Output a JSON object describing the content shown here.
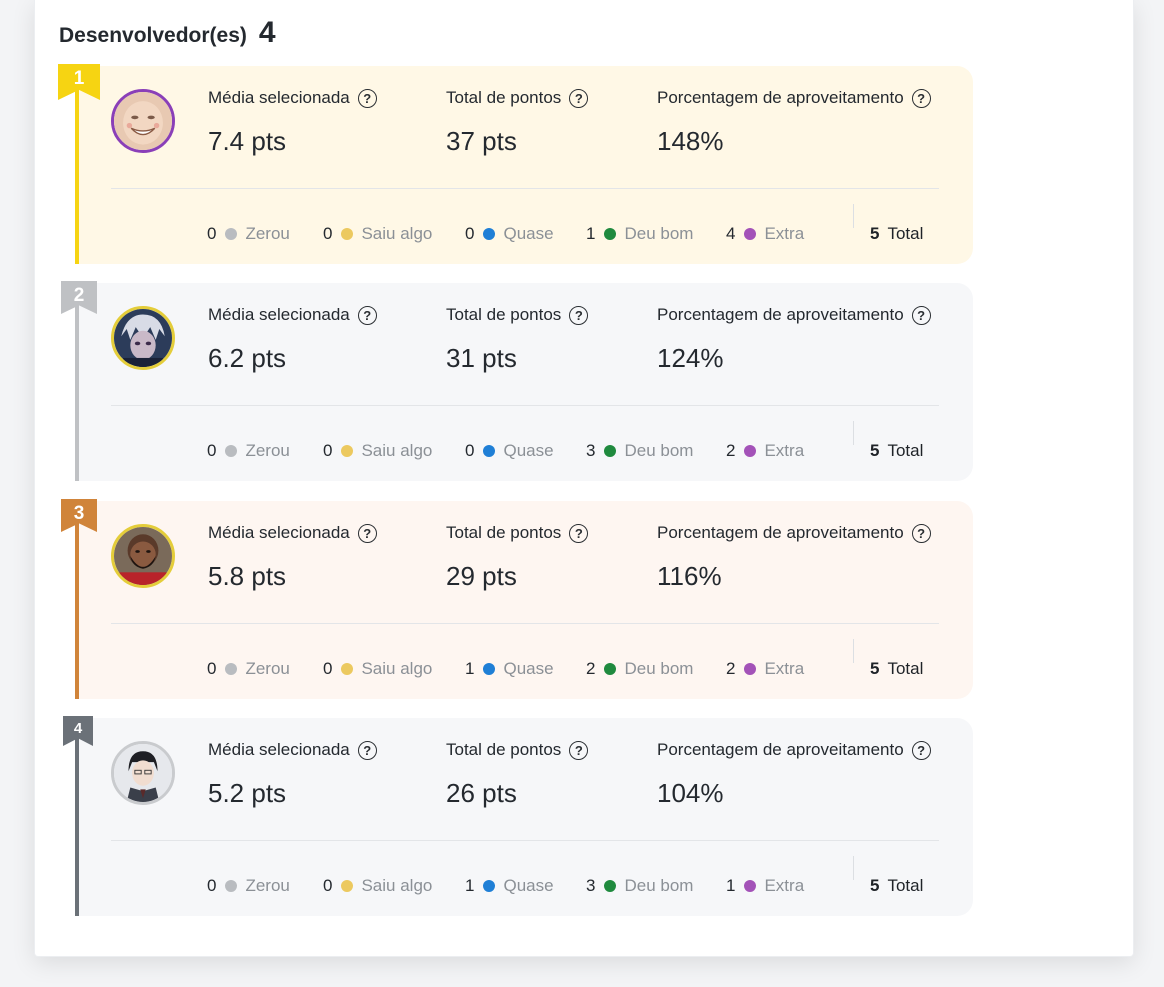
{
  "section": {
    "title": "Desenvolvedor(es)",
    "count": "4"
  },
  "labels": {
    "media": "Média selecionada",
    "total_pontos": "Total de pontos",
    "porcentagem": "Porcentagem de aproveitamento",
    "help_glyph": "?",
    "total": "Total"
  },
  "status_colors": {
    "zerou": "#b9bcc0",
    "saiu_algo": "#ecc95f",
    "quase": "#1f7fd6",
    "deu_bom": "#1f8a3e",
    "extra": "#a352b8"
  },
  "developers": [
    {
      "rank": "1",
      "media": "7.4 pts",
      "total_pontos": "37 pts",
      "porcentagem": "148%",
      "stats": [
        {
          "count": "0",
          "label": "Zerou"
        },
        {
          "count": "0",
          "label": "Saiu algo"
        },
        {
          "count": "0",
          "label": "Quase"
        },
        {
          "count": "1",
          "label": "Deu bom"
        },
        {
          "count": "4",
          "label": "Extra"
        }
      ],
      "total": "5",
      "accent": "#f6d412",
      "background": "#fff8e6",
      "avatar_ring": "#8a3fb8"
    },
    {
      "rank": "2",
      "media": "6.2 pts",
      "total_pontos": "31 pts",
      "porcentagem": "124%",
      "stats": [
        {
          "count": "0",
          "label": "Zerou"
        },
        {
          "count": "0",
          "label": "Saiu algo"
        },
        {
          "count": "0",
          "label": "Quase"
        },
        {
          "count": "3",
          "label": "Deu bom"
        },
        {
          "count": "2",
          "label": "Extra"
        }
      ],
      "total": "5",
      "accent": "#bfc1c4",
      "background": "#f6f7f9",
      "avatar_ring": "#e4cd3a"
    },
    {
      "rank": "3",
      "media": "5.8 pts",
      "total_pontos": "29 pts",
      "porcentagem": "116%",
      "stats": [
        {
          "count": "0",
          "label": "Zerou"
        },
        {
          "count": "0",
          "label": "Saiu algo"
        },
        {
          "count": "1",
          "label": "Quase"
        },
        {
          "count": "2",
          "label": "Deu bom"
        },
        {
          "count": "2",
          "label": "Extra"
        }
      ],
      "total": "5",
      "accent": "#d0843a",
      "background": "#fef6f1",
      "avatar_ring": "#e4cd3a"
    },
    {
      "rank": "4",
      "media": "5.2 pts",
      "total_pontos": "26 pts",
      "porcentagem": "104%",
      "stats": [
        {
          "count": "0",
          "label": "Zerou"
        },
        {
          "count": "0",
          "label": "Saiu algo"
        },
        {
          "count": "1",
          "label": "Quase"
        },
        {
          "count": "3",
          "label": "Deu bom"
        },
        {
          "count": "1",
          "label": "Extra"
        }
      ],
      "total": "5",
      "accent": "#6b7178",
      "background": "#f6f7f9",
      "avatar_ring": "#c9cbce"
    }
  ]
}
